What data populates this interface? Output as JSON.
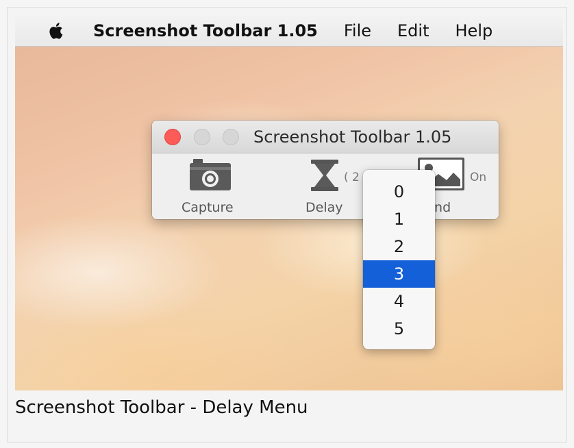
{
  "menubar": {
    "apple_icon": "apple-logo-icon",
    "app_name": "Screenshot Toolbar 1.05",
    "items": [
      "File",
      "Edit",
      "Help"
    ]
  },
  "window": {
    "title": "Screenshot Toolbar 1.05",
    "tools": {
      "capture": {
        "label": "Capture",
        "icon": "camera-icon"
      },
      "delay": {
        "label": "Delay",
        "icon": "hourglass-icon",
        "value_text": "( 2"
      },
      "background": {
        "label_visible": "und",
        "icon": "image-icon",
        "value_text": "On"
      }
    }
  },
  "delay_menu": {
    "options": [
      "0",
      "1",
      "2",
      "3",
      "4",
      "5"
    ],
    "selected": "3",
    "highlight_color": "#1460d8"
  },
  "caption": "Screenshot Toolbar - Delay Menu"
}
